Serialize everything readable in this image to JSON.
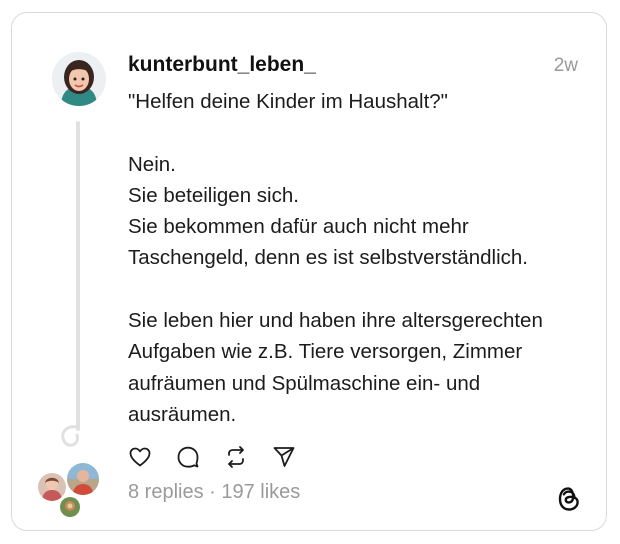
{
  "post": {
    "username": "kunterbunt_leben_",
    "time": "2w",
    "lines_block1": [
      "\"Helfen deine Kinder im Haushalt?\""
    ],
    "lines_block2": [
      "Nein.",
      "Sie beteiligen sich.",
      "Sie bekommen dafür auch nicht mehr",
      "Taschengeld, denn es ist selbstverständlich."
    ],
    "lines_block3": [
      "Sie leben hier und haben ihre altersgerechten",
      "Aufgaben wie z.B. Tiere versorgen, Zimmer",
      "aufräumen und Spülmaschine ein- und",
      "ausräumen."
    ],
    "stats": "8 replies · 197 likes"
  },
  "icons": {
    "like": "heart-icon",
    "reply": "comment-icon",
    "repost": "repost-icon",
    "share": "send-icon",
    "brand": "threads-logo-icon"
  },
  "colors": {
    "text": "#1c1c1c",
    "muted": "#9a9a9a",
    "border": "#d9d9d9",
    "thread_line": "#e1e1e1"
  }
}
